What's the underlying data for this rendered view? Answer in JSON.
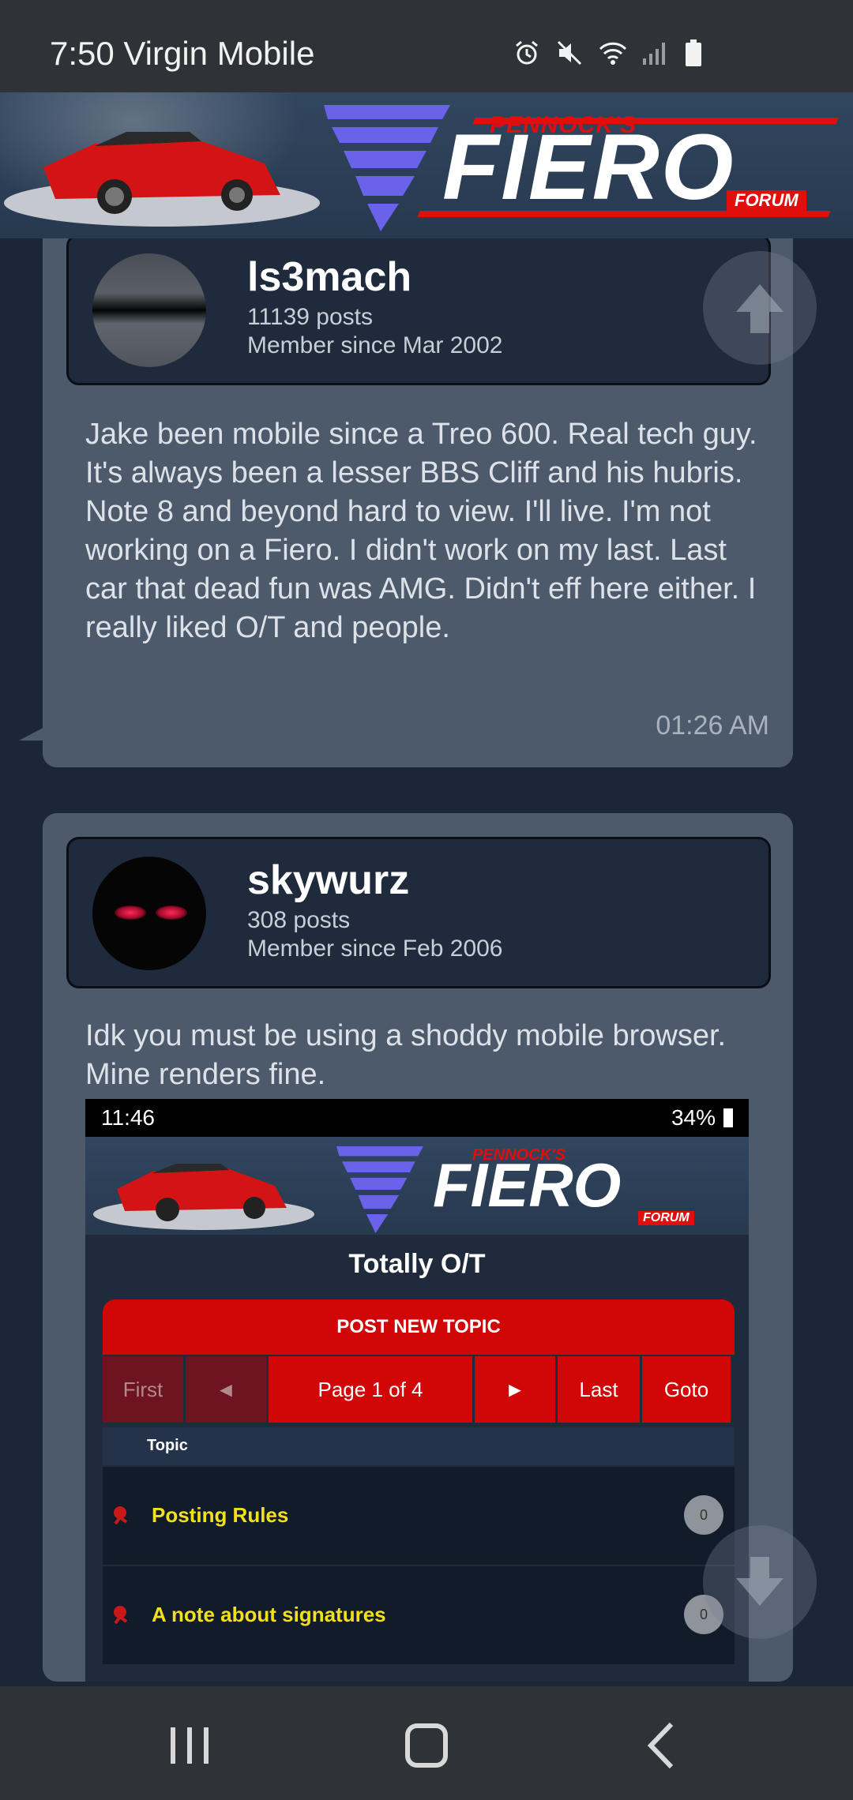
{
  "status_bar": {
    "time_carrier": "7:50 Virgin Mobile",
    "icons": [
      "alarm-icon",
      "mute-icon",
      "wifi-icon",
      "signal-icon",
      "battery-icon"
    ]
  },
  "forum_header": {
    "brand_top": "PENNOCK'S",
    "brand_main": "FIERO",
    "brand_sub": "FORUM"
  },
  "posts": [
    {
      "username": "ls3mach",
      "posts": "11139 posts",
      "member_since": "Member since Mar 2002",
      "text": "Jake been mobile since a Treo 600. Real tech guy. It's always been a lesser BBS Cliff and his hubris. Note 8 and beyond hard to view. I'll live. I'm not working on a Fiero. I didn't work on my last. Last car that dead fun was AMG. Didn't eff here either. I really liked O/T and people.",
      "time": "01:26 AM"
    },
    {
      "username": "skywurz",
      "posts": "308 posts",
      "member_since": "Member since Feb 2006",
      "text": "Idk you must be using a shoddy mobile browser. Mine renders fine."
    }
  ],
  "embedded_screenshot": {
    "status_time": "11:46",
    "battery": "34%",
    "brand_top": "PENNOCK'S",
    "brand_main": "FIERO",
    "brand_sub": "FORUM",
    "title": "Totally O/T",
    "post_new_topic": "POST NEW TOPIC",
    "pager": {
      "first": "First",
      "prev": "◄",
      "page": "Page 1 of 4",
      "next": "►",
      "last": "Last",
      "goto": "Goto"
    },
    "topic_header": "Topic",
    "topics": [
      {
        "title": "Posting Rules",
        "replies": "0"
      },
      {
        "title": "A note about signatures",
        "replies": "0"
      }
    ]
  },
  "colors": {
    "page_bg": "#1b2638",
    "post_bg": "#4d5a6c",
    "accent_red": "#d10707",
    "topic_yellow": "#f1e01b"
  }
}
